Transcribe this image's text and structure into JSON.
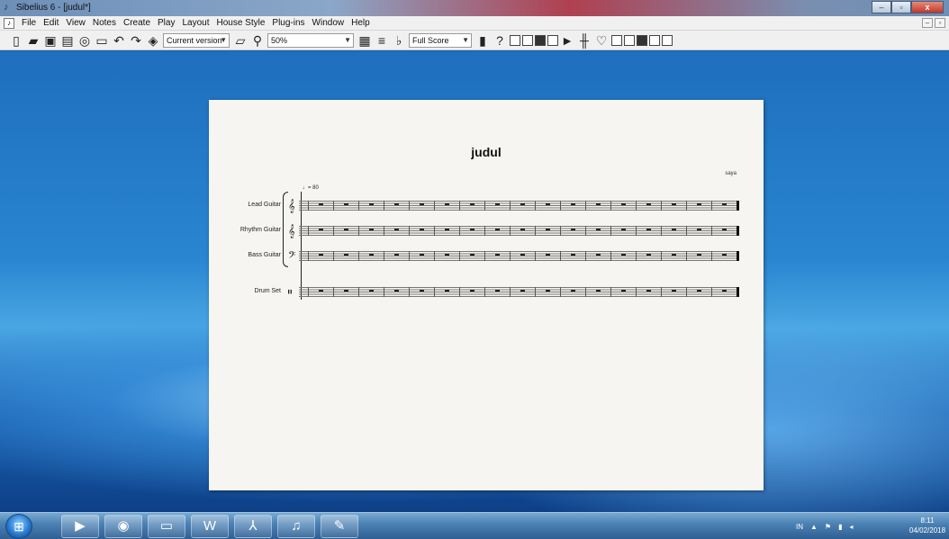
{
  "window": {
    "title": "Sibelius 6 - [judul*]",
    "controls": {
      "minimize": "–",
      "maximize": "▫",
      "close": "x"
    }
  },
  "menu": {
    "items": [
      "File",
      "Edit",
      "View",
      "Notes",
      "Create",
      "Play",
      "Layout",
      "House Style",
      "Plug-ins",
      "Window",
      "Help"
    ],
    "mdi_controls": {
      "minimize": "–",
      "restore": "▫"
    }
  },
  "toolbar": {
    "version_select": "Current version",
    "zoom_select": "50%",
    "view_select": "Full Score",
    "help_glyph": "?"
  },
  "score": {
    "title": "judul",
    "composer": "saya",
    "tempo": "♩= 80",
    "instruments": [
      {
        "name": "Lead Guitar",
        "clef": "𝄞"
      },
      {
        "name": "Rhythm Guitar",
        "clef": "𝄞"
      },
      {
        "name": "Bass Guitar",
        "clef": "𝄢"
      },
      {
        "name": "Drum Set",
        "clef": "𝄥"
      }
    ],
    "measures": 17
  },
  "taskbar": {
    "start_glyph": "⊞",
    "apps": [
      {
        "name": "media-player",
        "glyph": "▶"
      },
      {
        "name": "firefox",
        "glyph": "◉"
      },
      {
        "name": "file-explorer",
        "glyph": "▭"
      },
      {
        "name": "word",
        "glyph": "W"
      },
      {
        "name": "acrobat",
        "glyph": "⅄"
      },
      {
        "name": "sibelius",
        "glyph": "♫"
      },
      {
        "name": "paint",
        "glyph": "✎"
      }
    ],
    "tray": {
      "language": "IN",
      "show_hidden": "▲"
    },
    "clock": {
      "time": "8:11",
      "date": "04/02/2018"
    }
  }
}
